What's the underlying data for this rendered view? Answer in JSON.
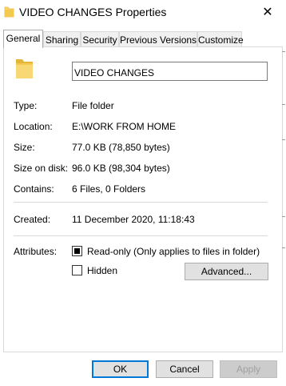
{
  "window": {
    "title": "VIDEO CHANGES Properties",
    "close_glyph": "✕"
  },
  "tabs": [
    {
      "label": "General",
      "active": true
    },
    {
      "label": "Sharing",
      "active": false
    },
    {
      "label": "Security",
      "active": false
    },
    {
      "label": "Previous Versions",
      "active": false
    },
    {
      "label": "Customize",
      "active": false
    }
  ],
  "general": {
    "folder_name": "VIDEO CHANGES",
    "type_label": "Type:",
    "type_value": "File folder",
    "location_label": "Location:",
    "location_value": "E:\\WORK FROM HOME",
    "size_label": "Size:",
    "size_value": "77.0 KB (78,850 bytes)",
    "size_on_disk_label": "Size on disk:",
    "size_on_disk_value": "96.0 KB (98,304 bytes)",
    "contains_label": "Contains:",
    "contains_value": "6 Files, 0 Folders",
    "created_label": "Created:",
    "created_value": "11 December 2020, 11:18:43",
    "attributes_label": "Attributes:",
    "readonly_label": "Read-only (Only applies to files in folder)",
    "readonly_state": "indeterminate",
    "hidden_label": "Hidden",
    "hidden_checked": false,
    "advanced_button": "Advanced..."
  },
  "footer": {
    "ok": "OK",
    "cancel": "Cancel",
    "apply": "Apply",
    "apply_enabled": false
  },
  "icons": {
    "title_icon": "folder-icon",
    "big_icon": "folder-icon"
  },
  "colors": {
    "folder_yellow": "#f8d775",
    "folder_dark": "#e5b53a",
    "accent_blue": "#0078d7"
  }
}
